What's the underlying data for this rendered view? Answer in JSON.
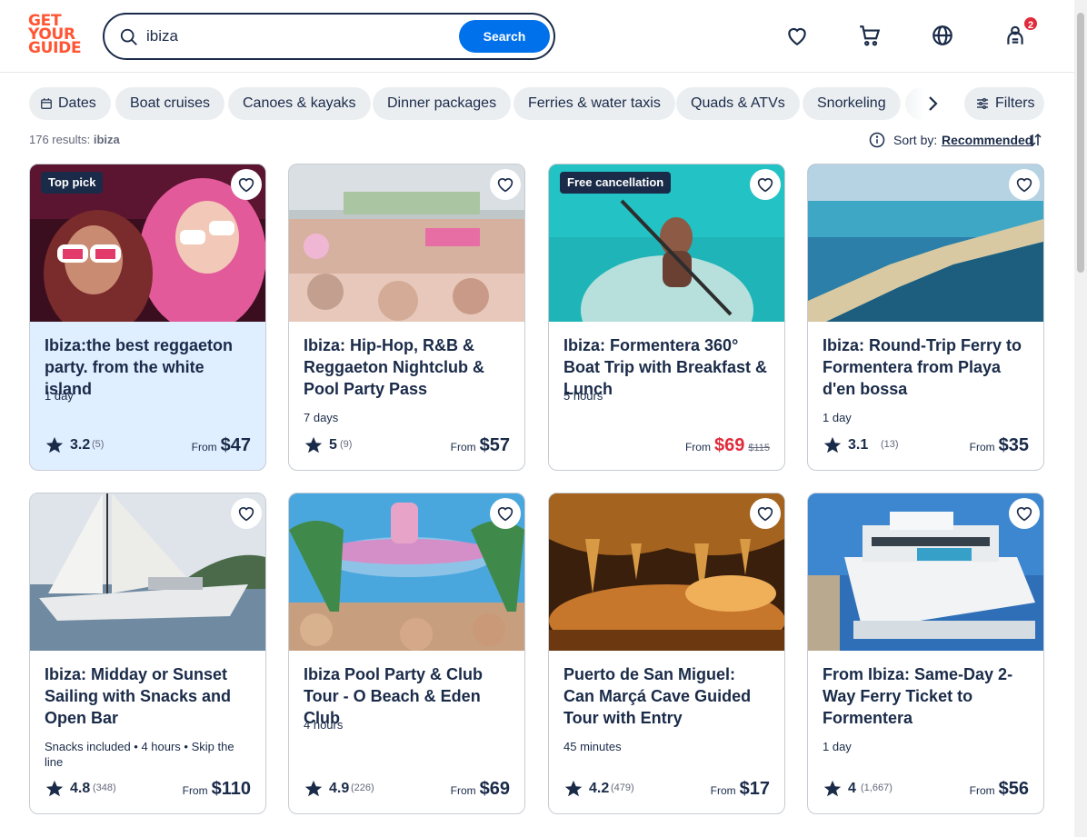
{
  "header": {
    "logo_lines": [
      "GET",
      "YOUR",
      "GUIDE"
    ],
    "search_value": "ibiza",
    "search_button": "Search",
    "cart_badge": "2",
    "icons": [
      "heart-icon",
      "cart-icon",
      "globe-icon",
      "user-icon"
    ]
  },
  "chips": [
    "Dates",
    "Boat cruises",
    "Canoes & kayaks",
    "Dinner packages",
    "Ferries & water taxis",
    "Quads & ATVs",
    "Snorkeling"
  ],
  "filters_label": "Filters",
  "results": {
    "count_text": "176 results:",
    "query": "ibiza"
  },
  "sort": {
    "label": "Sort by:",
    "value": "Recommended"
  },
  "cards": [
    {
      "tag": "Top pick",
      "title": "Ibiza:the best reggaeton party. from the white island",
      "meta": "1 day",
      "rating": "3.2",
      "reviews": "(5)",
      "from": "From",
      "price": "$47",
      "old_price": "",
      "highlight": true
    },
    {
      "tag": "",
      "title": "Ibiza: Hip-Hop, R&B & Reggaeton Nightclub & Pool Party Pass",
      "meta": "7 days",
      "rating": "5",
      "reviews": "(9)",
      "from": "From",
      "price": "$57",
      "old_price": ""
    },
    {
      "tag": "Free cancellation",
      "title": "Ibiza: Formentera 360° Boat Trip with Breakfast & Lunch",
      "meta": "5 hours",
      "rating": "",
      "reviews": "",
      "from": "From",
      "price": "$69",
      "old_price": "$115"
    },
    {
      "tag": "",
      "title": "Ibiza: Round-Trip Ferry to Formentera from Playa d'en bossa",
      "meta": "1 day",
      "rating": "3.1",
      "reviews": "(13)",
      "from": "From",
      "price": "$35",
      "old_price": ""
    },
    {
      "tag": "",
      "title": "Ibiza: Midday or Sunset Sailing with Snacks and Open Bar",
      "meta": "Snacks included • 4 hours • Skip the line",
      "rating": "4.8",
      "reviews": "(348)",
      "from": "From",
      "price": "$110",
      "old_price": ""
    },
    {
      "tag": "",
      "title": "Ibiza Pool Party & Club Tour - O Beach & Eden Club",
      "meta": "4 hours",
      "rating": "4.9",
      "reviews": "(226)",
      "from": "From",
      "price": "$69",
      "old_price": ""
    },
    {
      "tag": "",
      "title": "Puerto de San Miguel: Can Marçá Cave Guided Tour with Entry",
      "meta": "45 minutes",
      "rating": "4.2",
      "reviews": "(479)",
      "from": "From",
      "price": "$17",
      "old_price": ""
    },
    {
      "tag": "",
      "title": "From Ibiza: Same-Day 2-Way Ferry Ticket to Formentera",
      "meta": "1 day",
      "rating": "4",
      "reviews": "(1,667)",
      "from": "From",
      "price": "$56",
      "old_price": ""
    }
  ],
  "colors": {
    "brand": "#ff5533",
    "primary": "#0071eb",
    "text": "#1a2b49",
    "sale": "#e02b3c",
    "highlight_bg": "#e0efff"
  }
}
